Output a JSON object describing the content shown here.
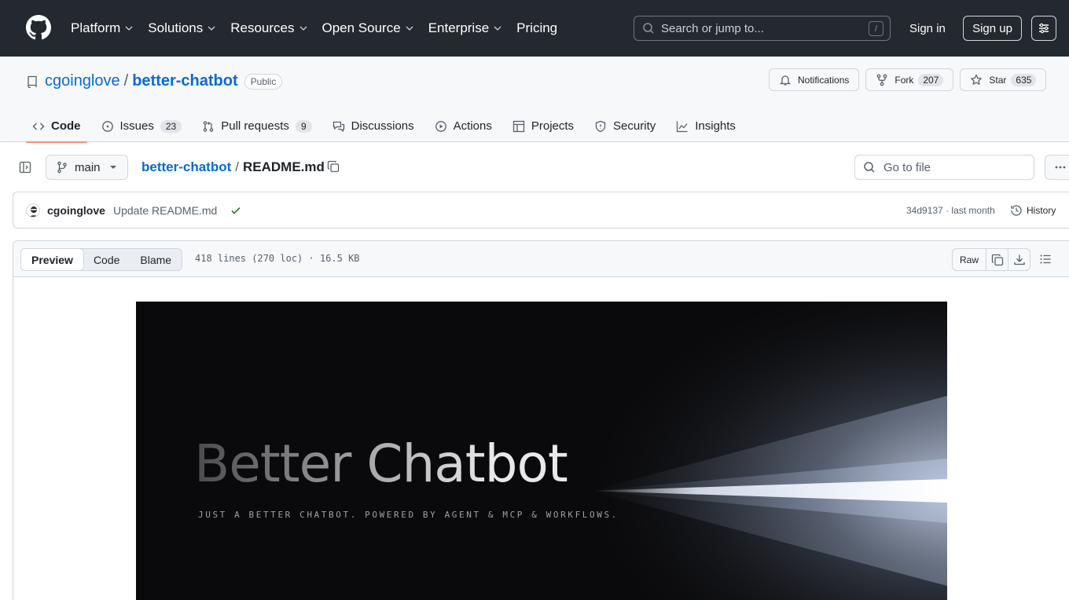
{
  "topnav": {
    "items": [
      {
        "label": "Platform",
        "dropdown": true
      },
      {
        "label": "Solutions",
        "dropdown": true
      },
      {
        "label": "Resources",
        "dropdown": true
      },
      {
        "label": "Open Source",
        "dropdown": true
      },
      {
        "label": "Enterprise",
        "dropdown": true
      },
      {
        "label": "Pricing",
        "dropdown": false
      }
    ],
    "search_placeholder": "Search or jump to...",
    "search_shortcut": "/",
    "signin": "Sign in",
    "signup": "Sign up"
  },
  "repo": {
    "owner": "cgoinglove",
    "separator": "/",
    "name": "better-chatbot",
    "visibility": "Public",
    "notifications_label": "Notifications",
    "fork_label": "Fork",
    "fork_count": "207",
    "star_label": "Star",
    "star_count": "635"
  },
  "tabs": [
    {
      "label": "Code",
      "icon": "code-icon",
      "active": true
    },
    {
      "label": "Issues",
      "icon": "issue-icon",
      "count": "23"
    },
    {
      "label": "Pull requests",
      "icon": "pull-request-icon",
      "count": "9"
    },
    {
      "label": "Discussions",
      "icon": "discussions-icon"
    },
    {
      "label": "Actions",
      "icon": "play-icon"
    },
    {
      "label": "Projects",
      "icon": "table-icon"
    },
    {
      "label": "Security",
      "icon": "shield-icon"
    },
    {
      "label": "Insights",
      "icon": "graph-icon"
    }
  ],
  "filenav": {
    "branch": "main",
    "crumb_repo": "better-chatbot",
    "crumb_sep": "/",
    "crumb_file": "README.md",
    "goto_placeholder": "Go to file"
  },
  "commit": {
    "author": "cgoinglove",
    "message": "Update README.md",
    "sha": "34d9137",
    "dot": "·",
    "time": "last month",
    "history_label": "History"
  },
  "fileview": {
    "modes": [
      "Preview",
      "Code",
      "Blame"
    ],
    "active_mode": "Preview",
    "info": "418 lines (270 loc) · 16.5 KB",
    "raw_label": "Raw"
  },
  "banner": {
    "title": "Better Chatbot",
    "subtitle": "JUST A BETTER CHATBOT. POWERED BY AGENT & MCP & WORKFLOWS."
  },
  "colors": {
    "header_bg": "#24292f",
    "link": "#0969da",
    "tab_underline": "#fd8c73",
    "check": "#1a7f37"
  }
}
